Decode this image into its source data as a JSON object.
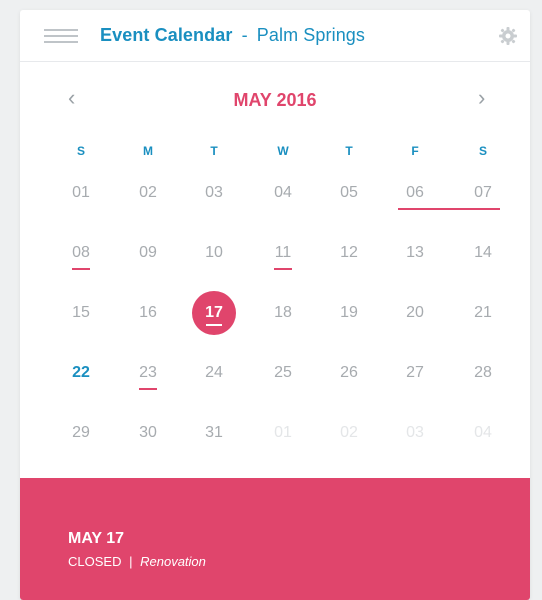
{
  "header": {
    "brand": "Event Calendar",
    "separator": "-",
    "location": "Palm Springs",
    "menu_icon": "hamburger-icon",
    "settings_icon": "gear-icon"
  },
  "calendar": {
    "month_label": "MAY 2016",
    "prev_icon": "chevron-left-icon",
    "next_icon": "chevron-right-icon",
    "weekdays": [
      "S",
      "M",
      "T",
      "W",
      "T",
      "F",
      "S"
    ],
    "weeks": [
      [
        "01",
        "02",
        "03",
        "04",
        "05",
        "06",
        "07"
      ],
      [
        "08",
        "09",
        "10",
        "11",
        "12",
        "13",
        "14"
      ],
      [
        "15",
        "16",
        "17",
        "18",
        "19",
        "20",
        "21"
      ],
      [
        "22",
        "23",
        "24",
        "25",
        "26",
        "27",
        "28"
      ],
      [
        "29",
        "30",
        "31",
        "01",
        "02",
        "03",
        "04"
      ]
    ]
  },
  "selected_event": {
    "date": "MAY 17",
    "status": "CLOSED",
    "separator": "|",
    "note": "Renovation"
  },
  "colors": {
    "accent_pink": "#e0456c",
    "accent_blue": "#1a8fc0",
    "muted_text": "#a7abaf"
  }
}
